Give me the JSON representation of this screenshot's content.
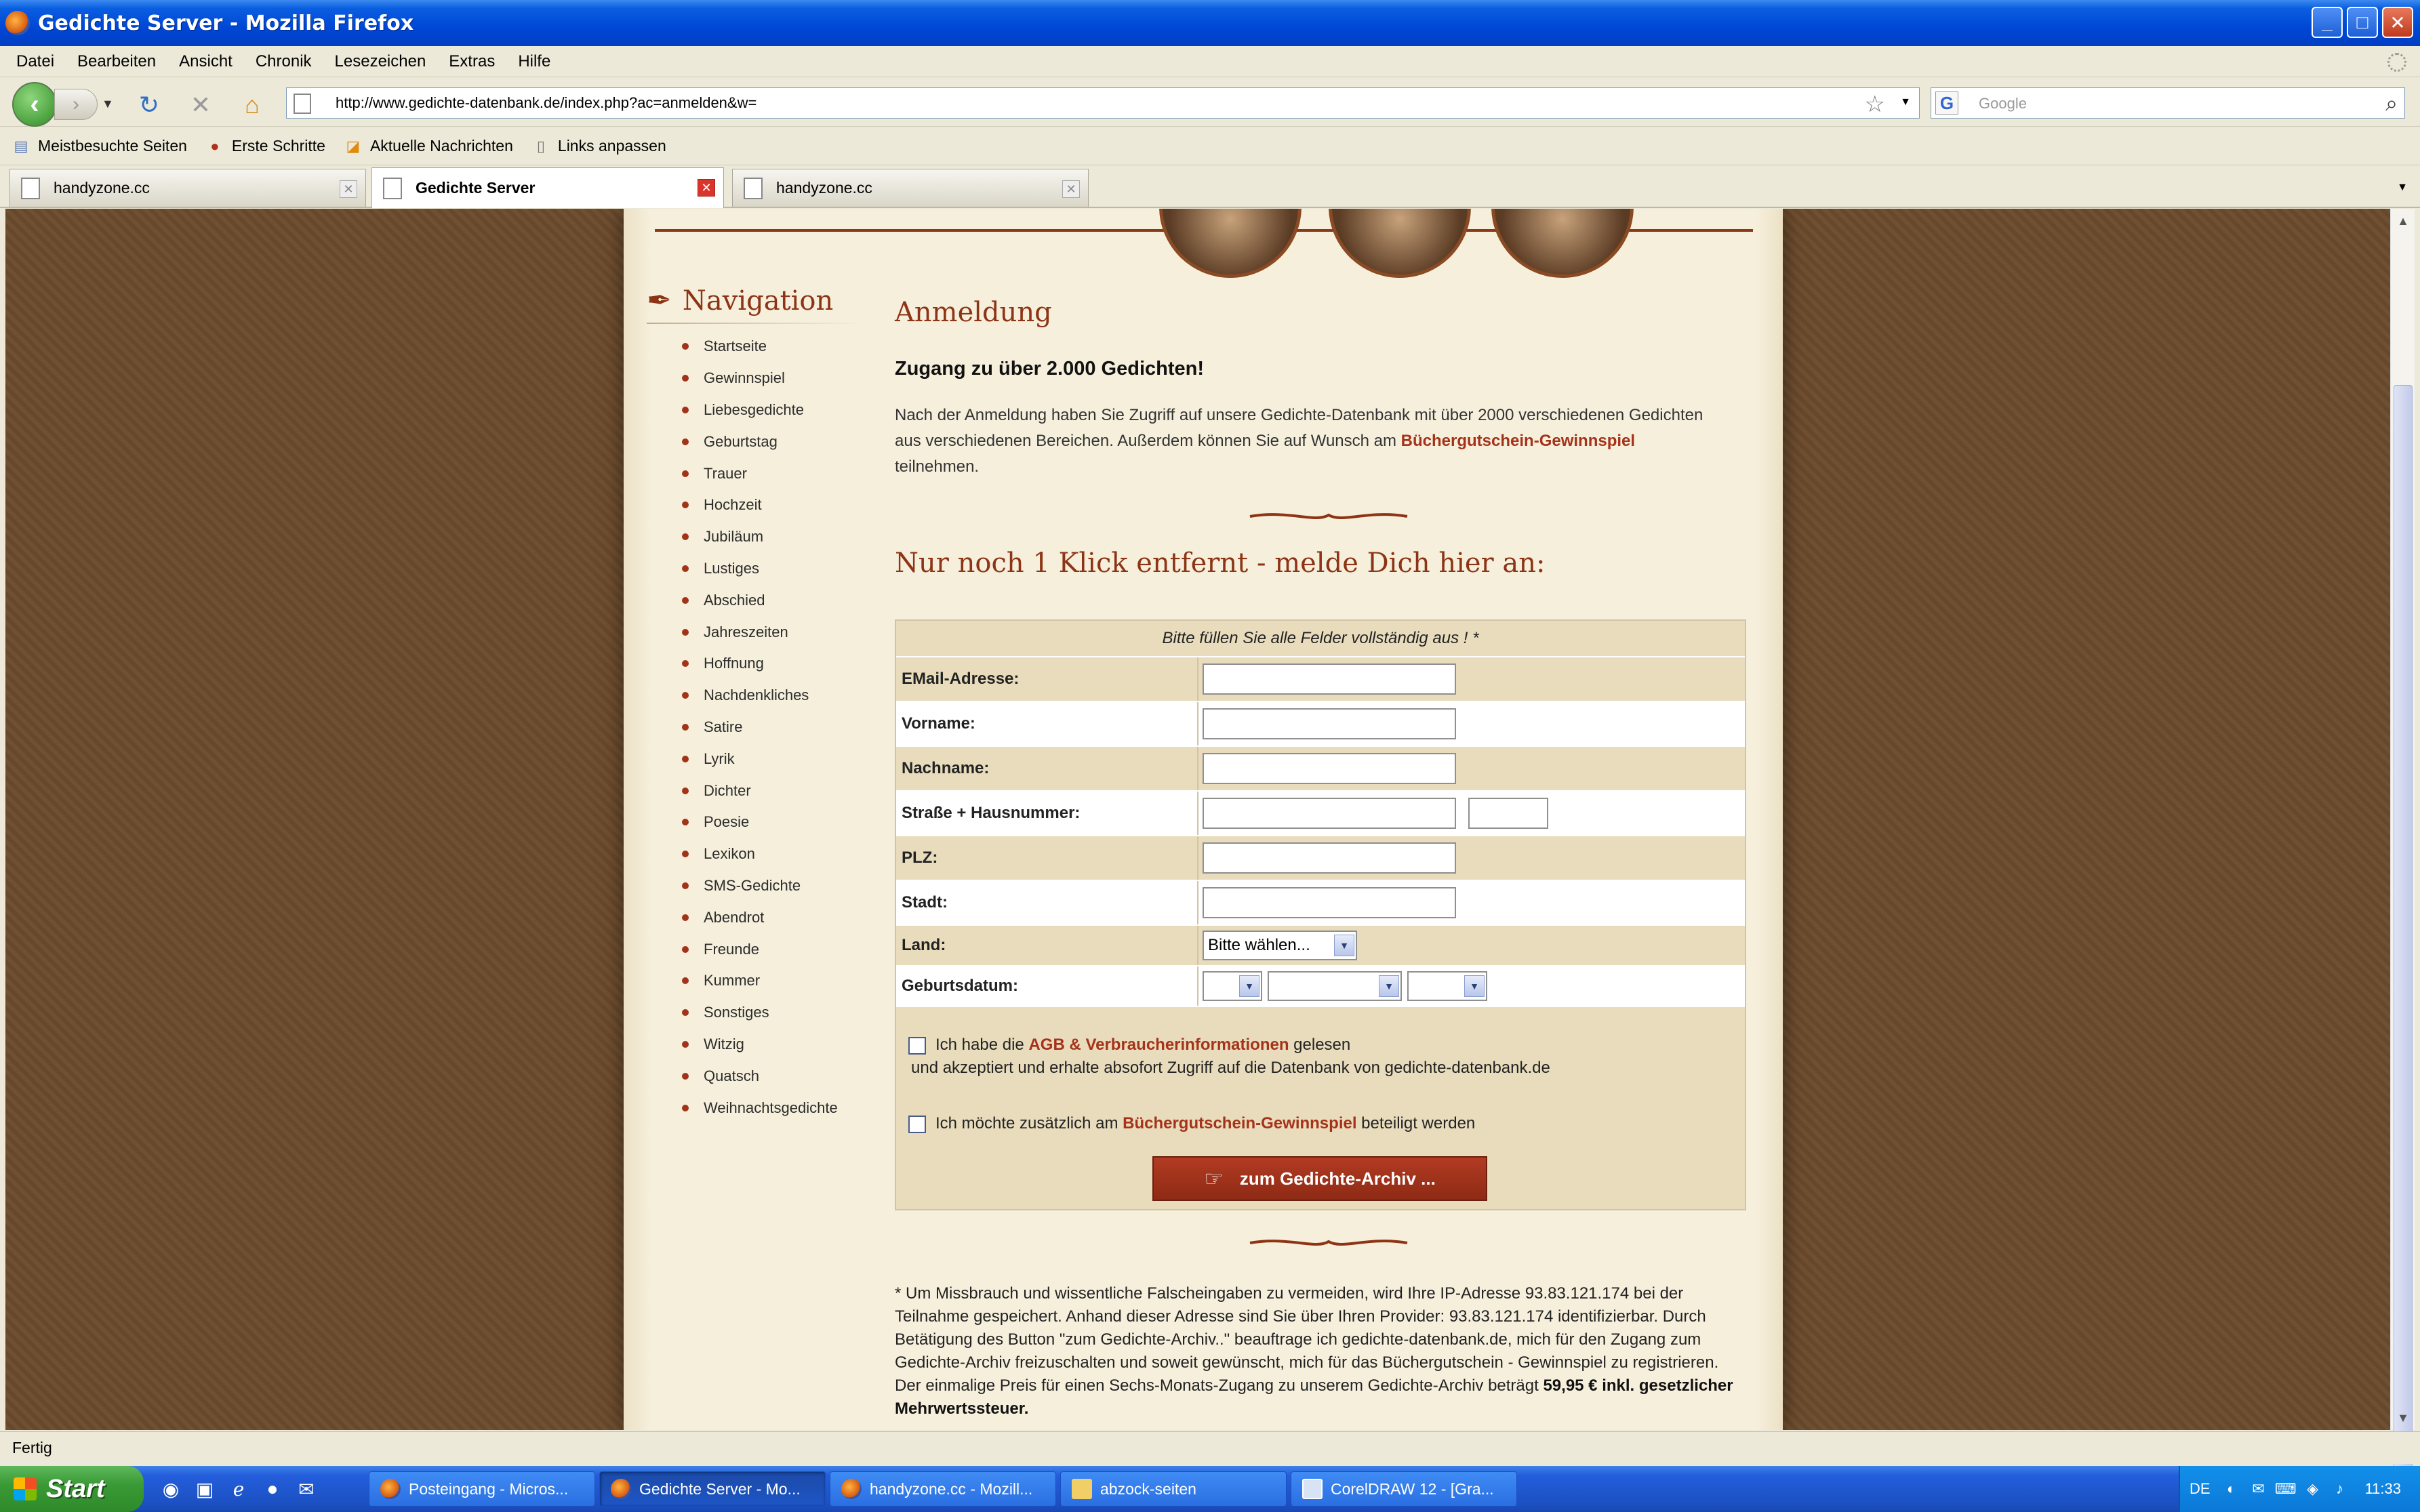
{
  "window": {
    "title": "Gedichte Server - Mozilla Firefox",
    "controls": {
      "minimize": "_",
      "maximize": "□",
      "close": "✕"
    }
  },
  "menu": [
    "Datei",
    "Bearbeiten",
    "Ansicht",
    "Chronik",
    "Lesezeichen",
    "Extras",
    "Hilfe"
  ],
  "toolbar": {
    "url": "http://www.gedichte-datenbank.de/index.php?ac=anmelden&w=",
    "search_placeholder": "Google",
    "search_engine_letter": "G"
  },
  "bookmarks": [
    "Meistbesuchte Seiten",
    "Erste Schritte",
    "Aktuelle Nachrichten",
    "Links anpassen"
  ],
  "tabs": [
    {
      "label": "handyzone.cc",
      "active": false
    },
    {
      "label": "Gedichte Server",
      "active": true
    },
    {
      "label": "handyzone.cc",
      "active": false
    }
  ],
  "page": {
    "nav_title": "Navigation",
    "nav_items": [
      "Startseite",
      "Gewinnspiel",
      "Liebesgedichte",
      "Geburtstag",
      "Trauer",
      "Hochzeit",
      "Jubiläum",
      "Lustiges",
      "Abschied",
      "Jahreszeiten",
      "Hoffnung",
      "Nachdenkliches",
      "Satire",
      "Lyrik",
      "Dichter",
      "Poesie",
      "Lexikon",
      "SMS-Gedichte",
      "Abendrot",
      "Freunde",
      "Kummer",
      "Sonstiges",
      "Witzig",
      "Quatsch",
      "Weihnachtsgedichte"
    ],
    "heading": "Anmeldung",
    "subheading": "Zugang zu über 2.000 Gedichten!",
    "intro_text": "Nach der Anmeldung haben Sie Zugriff auf unsere Gedichte-Datenbank mit über 2000 verschiedenen Gedichten aus verschiedenen Bereichen. Außerdem können Sie auf Wunsch am ",
    "intro_link": "Büchergutschein-Gewinnspiel",
    "intro_tail": " teilnehmen.",
    "cta_title": "Nur noch 1 Klick entfernt - melde Dich hier an:",
    "form": {
      "hint": "Bitte füllen Sie alle Felder vollständig aus ! *",
      "fields": {
        "email": "EMail-Adresse:",
        "vorname": "Vorname:",
        "nachname": "Nachname:",
        "strasse": "Straße + Hausnummer:",
        "plz": "PLZ:",
        "stadt": "Stadt:",
        "land": "Land:",
        "geburtsdatum": "Geburtsdatum:"
      },
      "land_selected": "Bitte wählen...",
      "agb_pre": "Ich habe die ",
      "agb_link": "AGB & Verbraucherinformationen",
      "agb_post": " gelesen",
      "agb_line2": "und akzeptiert und erhalte absofort Zugriff auf die Datenbank von gedichte-datenbank.de",
      "gewinnspiel_pre": "Ich möchte zusätzlich am ",
      "gewinnspiel_link": "Büchergutschein-Gewinnspiel",
      "gewinnspiel_post": " beteiligt werden",
      "submit_label": "zum Gedichte-Archiv ..."
    },
    "footnote": "* Um Missbrauch und wissentliche Falscheingaben zu vermeiden, wird Ihre IP-Adresse 93.83.121.174 bei der Teilnahme gespeichert. Anhand dieser Adresse sind Sie über Ihren Provider: 93.83.121.174 identifizierbar. Durch Betätigung des Button \"zum Gedichte-Archiv..\" beauftrage ich gedichte-datenbank.de, mich für den Zugang zum Gedichte-Archiv freizuschalten und soweit gewünscht, mich für das Büchergutschein - Gewinnspiel zu registrieren. Der einmalige Preis für einen Sechs-Monats-Zugang zu unserem Gedichte-Archiv beträgt ",
    "footnote_price": "59,95 € inkl. gesetzlicher Mehrwertssteuer."
  },
  "status": "Fertig",
  "taskbar": {
    "start": "Start",
    "buttons": [
      {
        "label": "Posteingang - Micros...",
        "active": false
      },
      {
        "label": "Gedichte Server - Mo...",
        "active": true
      },
      {
        "label": "handyzone.cc - Mozill...",
        "active": false
      },
      {
        "label": "abzock-seiten",
        "active": false
      },
      {
        "label": "CorelDRAW 12 - [Gra...",
        "active": false
      }
    ],
    "lang": "DE",
    "clock": "11:33"
  }
}
